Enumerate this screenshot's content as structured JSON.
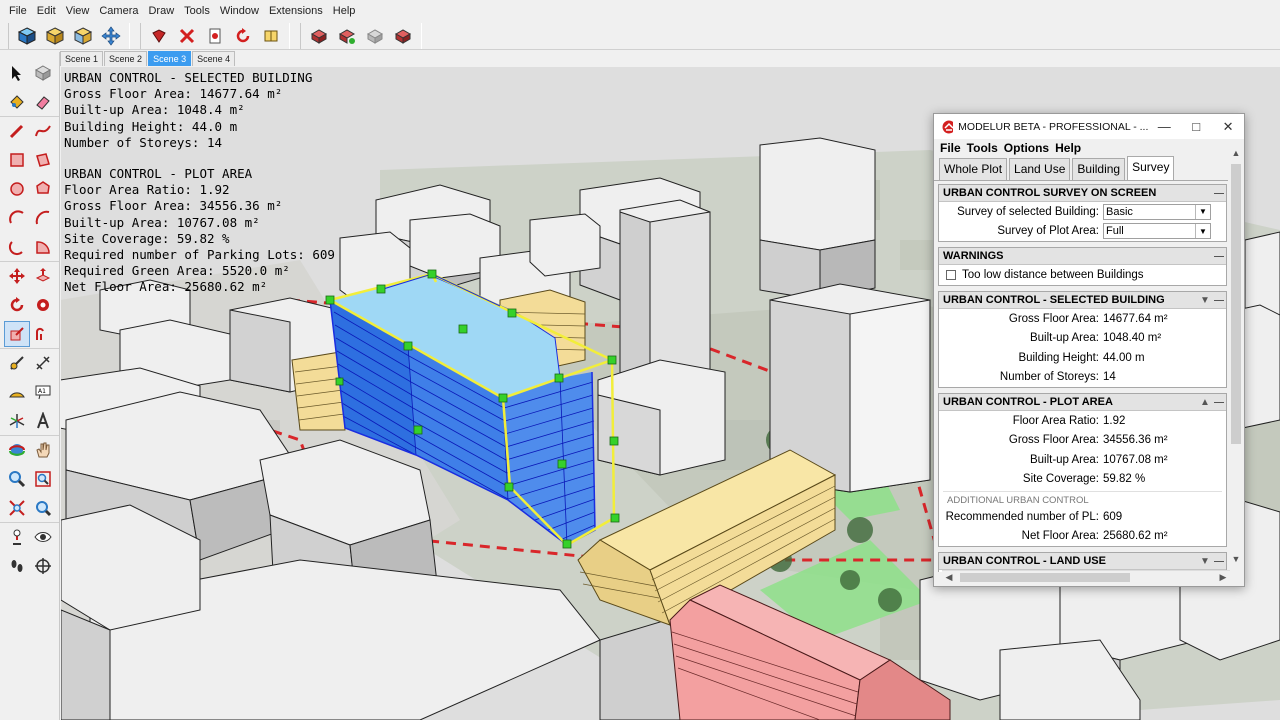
{
  "menu": [
    "File",
    "Edit",
    "View",
    "Camera",
    "Draw",
    "Tools",
    "Window",
    "Extensions",
    "Help"
  ],
  "toolbar_icons": [
    "cube-icon",
    "box-icon",
    "stack-icon",
    "move-arrows-icon",
    "ruby-icon",
    "delete-x-icon",
    "document-icon",
    "refresh-icon",
    "book-icon",
    "building-red-icon",
    "building-green-icon",
    "building-gray-icon",
    "building-red-2-icon"
  ],
  "scenes": [
    "Scene 1",
    "Scene 2",
    "Scene 3",
    "Scene 4"
  ],
  "active_scene": 2,
  "overlay": {
    "selected_title": "URBAN CONTROL - SELECTED BUILDING",
    "selected_lines": [
      "Gross Floor Area: 14677.64 m²",
      "Built-up Area: 1048.4 m²",
      "Building Height: 44.0 m",
      "Number of Storeys: 14"
    ],
    "plot_title": "URBAN CONTROL - PLOT AREA",
    "plot_lines": [
      "Floor Area Ratio: 1.92",
      "Gross Floor Area: 34556.36 m²",
      "Built-up Area: 10767.08 m²",
      "Site Coverage: 59.82 %",
      "Required number of Parking Lots: 609",
      "Required Green Area: 5520.0 m²",
      "Net Floor Area: 25680.62 m²"
    ]
  },
  "window": {
    "title": "MODELUR BETA - PROFESSIONAL - ...",
    "menu": [
      "File",
      "Tools",
      "Options",
      "Help"
    ],
    "tabs": [
      "Whole Plot",
      "Land Use",
      "Building",
      "Survey"
    ],
    "active_tab": 3,
    "survey_panel": {
      "title": "URBAN CONTROL SURVEY ON SCREEN",
      "rows": [
        {
          "label": "Survey of selected Building:",
          "value": "Basic"
        },
        {
          "label": "Survey of Plot Area:",
          "value": "Full"
        }
      ]
    },
    "warnings_panel": {
      "title": "WARNINGS",
      "checkbox_label": "Too low distance between Buildings"
    },
    "building_panel": {
      "title": "URBAN CONTROL - SELECTED BUILDING",
      "rows": [
        {
          "label": "Gross Floor Area:",
          "value": "14677.64 m²"
        },
        {
          "label": "Built-up Area:",
          "value": "1048.40 m²"
        },
        {
          "label": "Building Height:",
          "value": "44.00 m"
        },
        {
          "label": "Number of Storeys:",
          "value": "14"
        }
      ]
    },
    "plot_panel": {
      "title": "URBAN CONTROL - PLOT AREA",
      "rows": [
        {
          "label": "Floor Area Ratio:",
          "value": "1.92"
        },
        {
          "label": "Gross Floor Area:",
          "value": "34556.36 m²"
        },
        {
          "label": "Built-up Area:",
          "value": "10767.08 m²"
        },
        {
          "label": "Site Coverage:",
          "value": "59.82 %"
        }
      ],
      "subheading": "ADDITIONAL URBAN CONTROL",
      "extra_rows": [
        {
          "label": "Recommended number of PL:",
          "value": "609"
        },
        {
          "label": "Net Floor Area:",
          "value": "25680.62 m²"
        }
      ]
    },
    "landuse_panel": {
      "title": "URBAN CONTROL - LAND USE"
    }
  },
  "colors": {
    "selected_building": "#9fd8f5",
    "selection_lines": "#1a2de0",
    "bounding_box": "#f2ee3a",
    "grip": "#35d12a",
    "tan_building": "#f3dc98",
    "pink_building": "#f3a0a0",
    "green_area": "#8ee08a",
    "active_scene_tab": "#3b9cf0"
  }
}
